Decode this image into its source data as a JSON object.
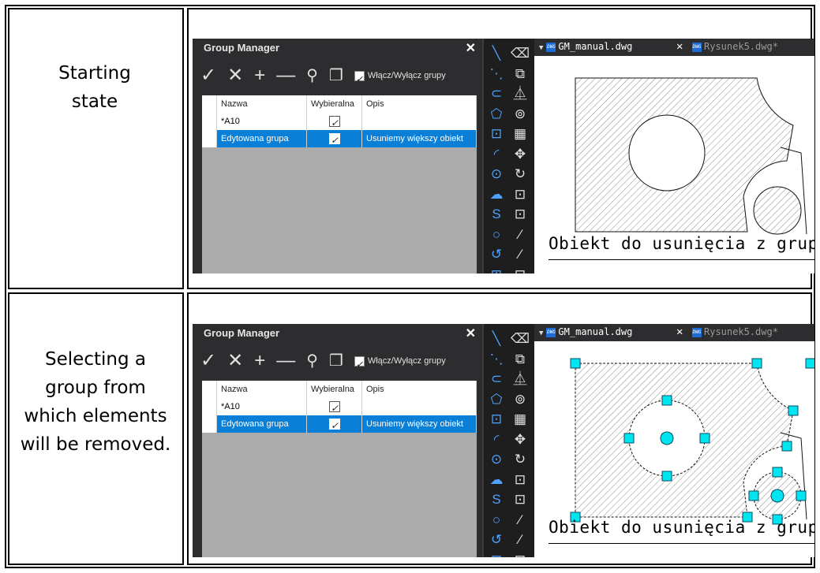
{
  "rows": [
    {
      "label": "Starting state",
      "panel": {
        "title": "Group Manager",
        "close": "✕",
        "toolbar": {
          "apply": "✓",
          "cancel": "✕",
          "add": "+",
          "remove": "—",
          "find": "⚲",
          "copy": "❐",
          "toggle_label": "Włącz/Wyłącz grupy"
        },
        "columns": [
          "Nazwa",
          "Wybieralna",
          "Opis"
        ],
        "groups": [
          {
            "name": "*A10",
            "selectable": true,
            "description": "",
            "selected": false
          },
          {
            "name": "Edytowana grupa",
            "selectable": true,
            "description": "Usuniemy większy obiekt",
            "selected": true
          }
        ]
      },
      "tabs": {
        "active": "GM_manual.dwg",
        "close": "✕",
        "other": "Rysunek5.dwg*"
      },
      "caption": "Obiekt do usunięcia z grupy",
      "selection_grips": false
    },
    {
      "label": "Selecting a group from which elements will be removed.",
      "panel": {
        "title": "Group Manager",
        "close": "✕",
        "toolbar": {
          "apply": "✓",
          "cancel": "✕",
          "add": "+",
          "remove": "—",
          "find": "⚲",
          "copy": "❐",
          "toggle_label": "Włącz/Wyłącz grupy"
        },
        "columns": [
          "Nazwa",
          "Wybieralna",
          "Opis"
        ],
        "groups": [
          {
            "name": "*A10",
            "selectable": true,
            "description": "",
            "selected": false
          },
          {
            "name": "Edytowana grupa",
            "selectable": true,
            "description": "Usuniemy większy obiekt",
            "selected": true
          }
        ]
      },
      "tabs": {
        "active": "GM_manual.dwg",
        "close": "✕",
        "other": "Rysunek5.dwg*"
      },
      "caption": "Obiekt do usunięcia z grupy",
      "selection_grips": true
    }
  ],
  "tool_icons": {
    "draw": [
      "╲",
      "⋱",
      "⊂",
      "⬠",
      "⊡",
      "◜",
      "⊙",
      "☁",
      "S",
      "○",
      "↺",
      "⊞"
    ],
    "modify": [
      "⌫",
      "⧉",
      "⏅",
      "⊚",
      "▦",
      "✥",
      "↻",
      "⊡",
      "⊡",
      "⁄",
      "⁄",
      "⊟"
    ]
  },
  "colors": {
    "selection": "#0a7fd8",
    "grip": "#00e5ef",
    "draw_icons": "#4fa3ff"
  }
}
